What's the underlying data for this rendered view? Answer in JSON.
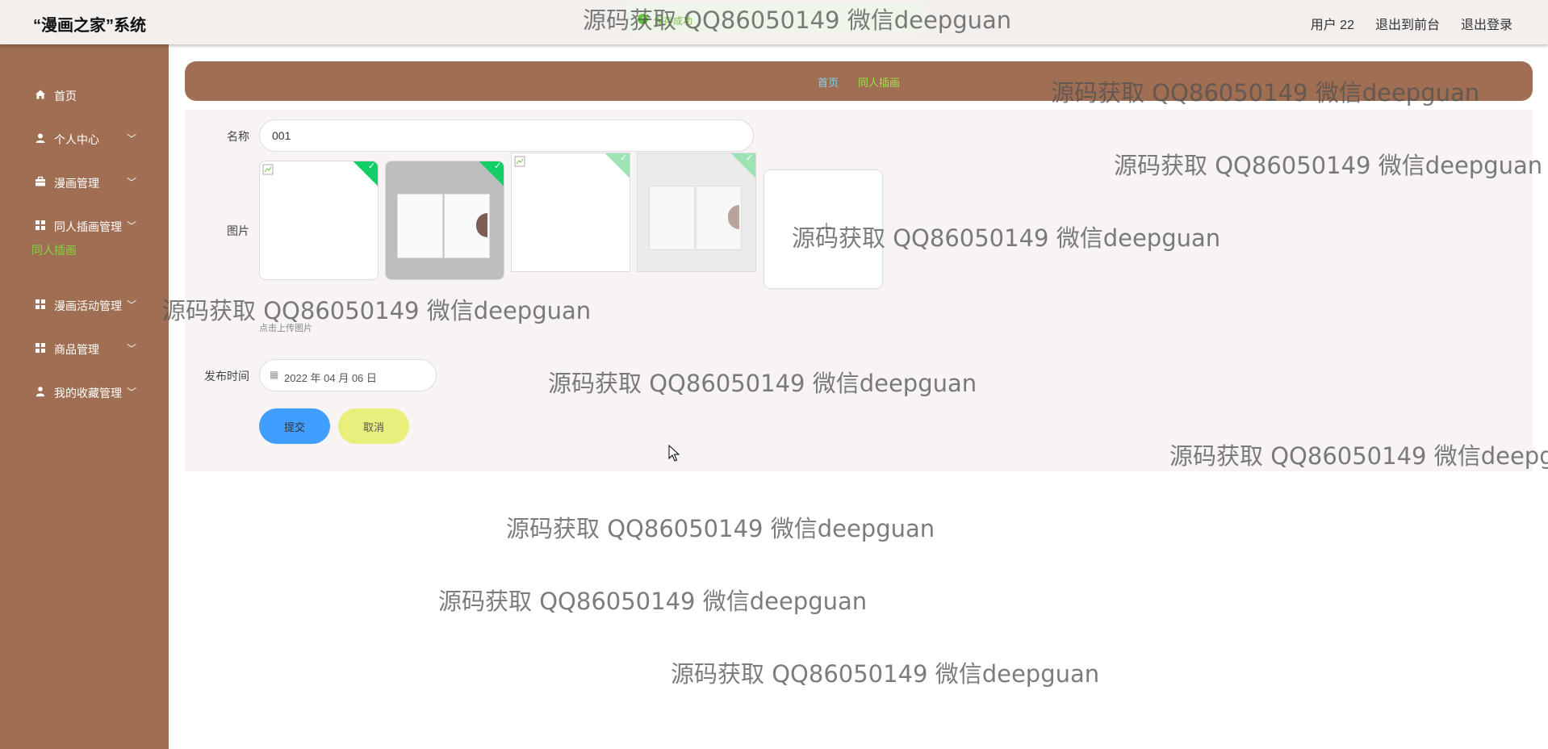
{
  "header": {
    "app_title": "“漫画之家”系统",
    "toast": "保存成功",
    "user": "用户 22",
    "front_link": "退出到前台",
    "logout_link": "退出登录"
  },
  "sidebar": {
    "items": [
      {
        "label": "首页",
        "icon": "home-icon",
        "expandable": false
      },
      {
        "label": "个人中心",
        "icon": "user-icon",
        "expandable": true
      },
      {
        "label": "漫画管理",
        "icon": "briefcase-icon",
        "expandable": true
      },
      {
        "label": "同人插画管理",
        "icon": "grid-icon",
        "expandable": true
      },
      {
        "label": "漫画活动管理",
        "icon": "grid-icon",
        "expandable": true
      },
      {
        "label": "商品管理",
        "icon": "grid-icon",
        "expandable": true
      },
      {
        "label": "我的收藏管理",
        "icon": "person-icon",
        "expandable": true
      }
    ],
    "active_sub": "同人插画"
  },
  "breadcrumb": {
    "home": "首页",
    "separator": "",
    "current": "同人插画"
  },
  "form": {
    "name_label": "名称",
    "name_value": "001",
    "image_label": "图片",
    "upload_hint": "点击上传图片",
    "date_label": "发布时间",
    "date_value": "2022 年 04 月 06 日",
    "submit_label": "提交",
    "cancel_label": "取消"
  },
  "watermark": "源码获取 QQ86050149 微信deepguan",
  "colors": {
    "sidebar_bg": "#a06f53",
    "topbar_bg": "#f3efed",
    "panel_bg": "#f8f4f3",
    "submit_bg": "#409eff",
    "cancel_bg": "#e8ef7c",
    "active_sub": "#7fd33f",
    "check_badge": "#13ce66"
  }
}
